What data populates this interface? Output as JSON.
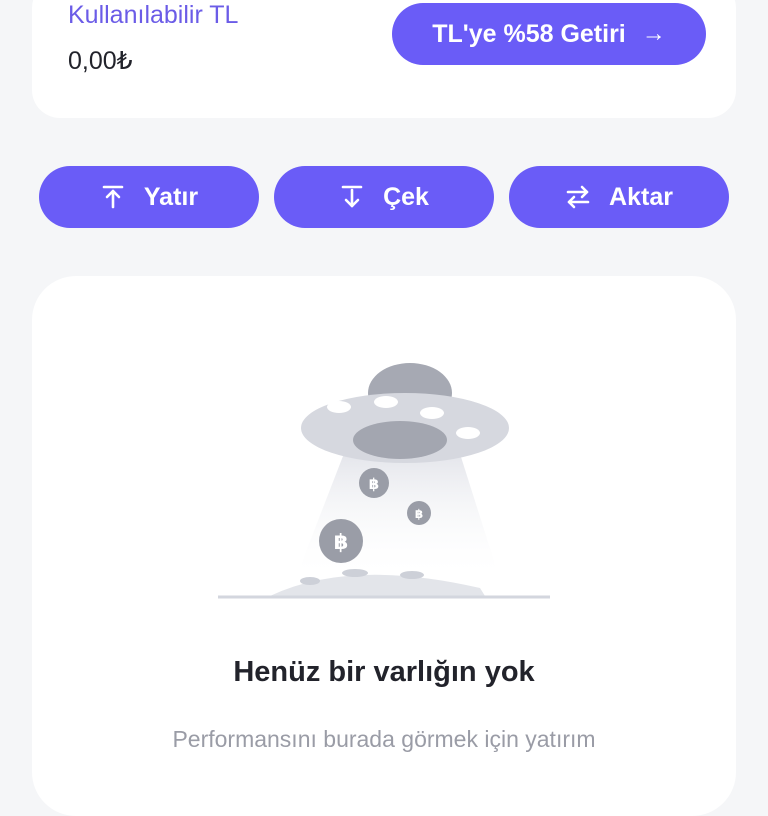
{
  "wallet": {
    "available_label": "Kullanılabilir TL",
    "available_value": "0,00₺",
    "yield_button_label": "TL'ye %58 Getiri",
    "yield_arrow": "→"
  },
  "actions": {
    "deposit_label": "Yatır",
    "withdraw_label": "Çek",
    "transfer_label": "Aktar"
  },
  "empty_state": {
    "title": "Henüz bir varlığın yok",
    "description": "Performansını burada görmek için yatırım",
    "illustration_icon": "ufo-coins-illustration",
    "coin_glyph": "฿"
  },
  "colors": {
    "accent": "#6a5cf7",
    "label_purple": "#6b5ce7",
    "text_dark": "#22232b",
    "text_muted": "#9a9ca6",
    "page_bg": "#f5f6f8"
  }
}
